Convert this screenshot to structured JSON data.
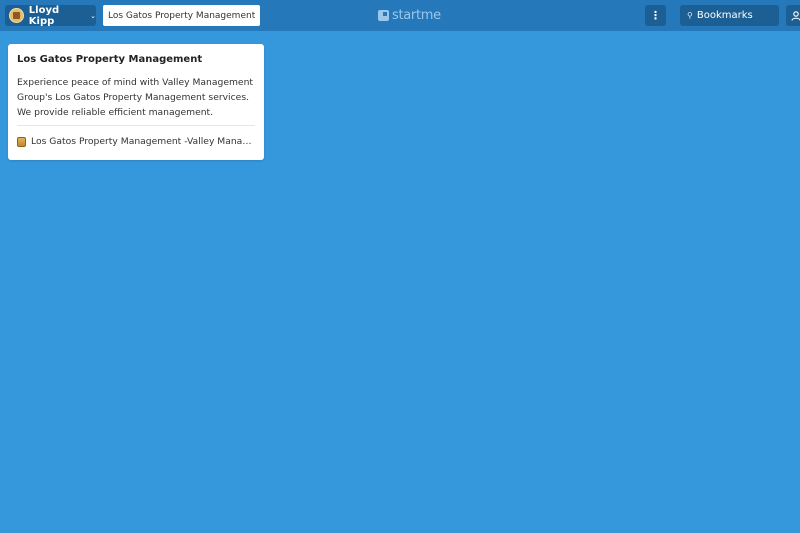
{
  "topbar": {
    "user_name": "Lloyd Kipp",
    "page_tab_label": "Los Gatos Property Management",
    "logo_text": "startme",
    "search_placeholder": "Bookmarks"
  },
  "widget": {
    "title": "Los Gatos Property Management",
    "description": "Experience peace of mind with Valley Management Group's Los Gatos Property Management services. We provide reliable efficient management.",
    "bookmarks": [
      {
        "label": "Los Gatos Property Management -Valley Managm..."
      }
    ]
  },
  "colors": {
    "background": "#3597DC",
    "topbar": "#2578B9",
    "button": "#1C5F94"
  }
}
